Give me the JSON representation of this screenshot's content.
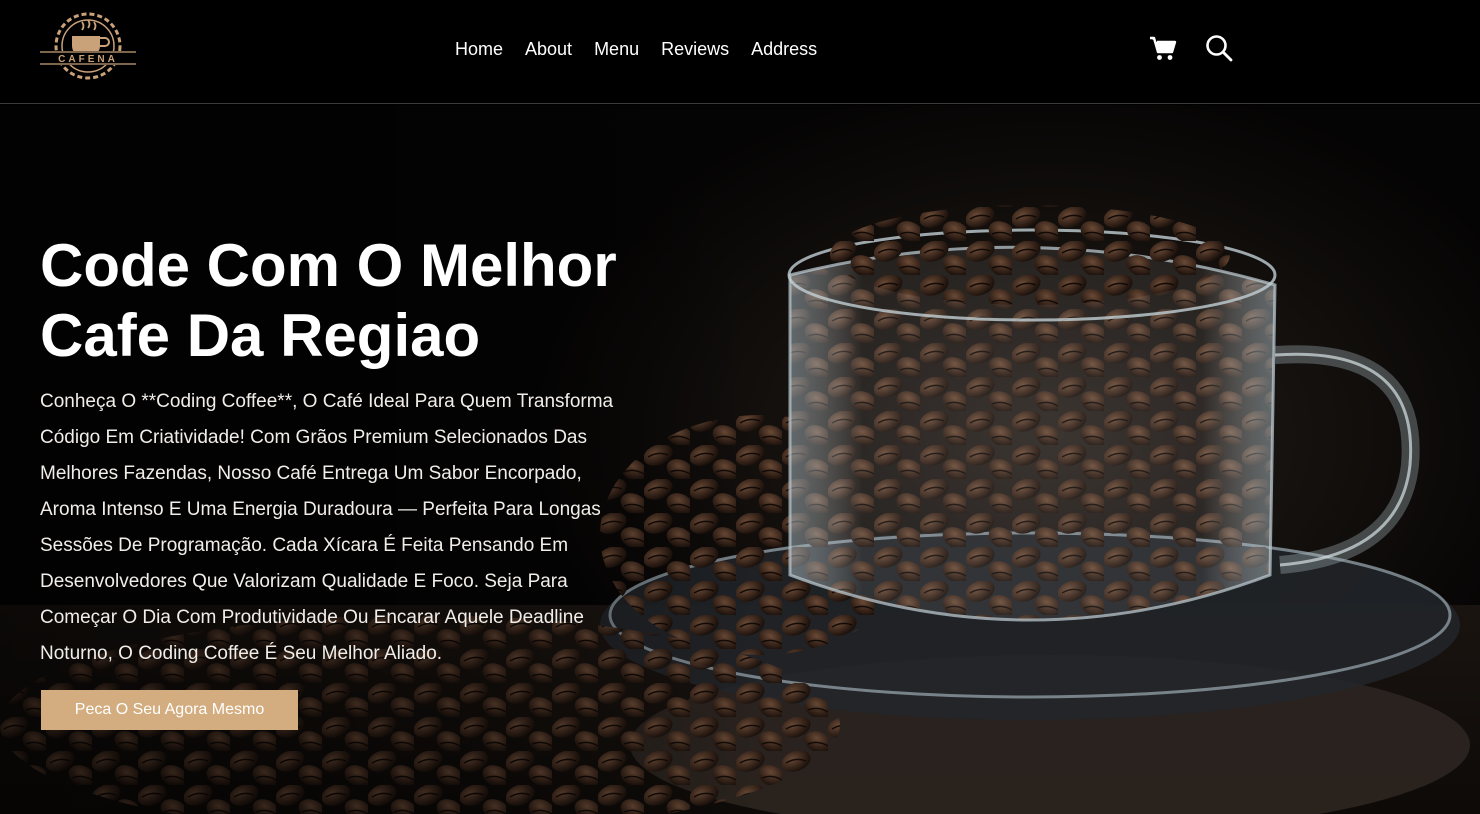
{
  "header": {
    "logo_text": "CAFENA",
    "nav": [
      {
        "label": "Home"
      },
      {
        "label": "About"
      },
      {
        "label": "Menu"
      },
      {
        "label": "Reviews"
      },
      {
        "label": "Address"
      }
    ],
    "icons": [
      "cart-icon",
      "search-icon"
    ]
  },
  "hero": {
    "title_line1": "Code Com O Melhor",
    "title_line2": "Cafe Da Regiao",
    "description": "Conheça O **Coding Coffee**, O Café Ideal Para Quem Transforma Código Em Criatividade! Com Grãos Premium Selecionados Das Melhores Fazendas, Nosso Café Entrega Um Sabor Encorpado, Aroma Intenso E Uma Energia Duradoura — Perfeita Para Longas Sessões De Programação. Cada Xícara É Feita Pensando Em Desenvolvedores Que Valorizam Qualidade E Foco. Seja Para Começar O Dia Com Produtividade Ou Encarar Aquele Deadline Noturno, O Coding Coffee É Seu Melhor Aliado.",
    "cta_label": "Peca O Seu Agora Mesmo",
    "image": "coffee-beans-glass-cup"
  },
  "colors": {
    "accent": "#d3ad7f",
    "background": "#000000",
    "text": "#ffffff"
  }
}
